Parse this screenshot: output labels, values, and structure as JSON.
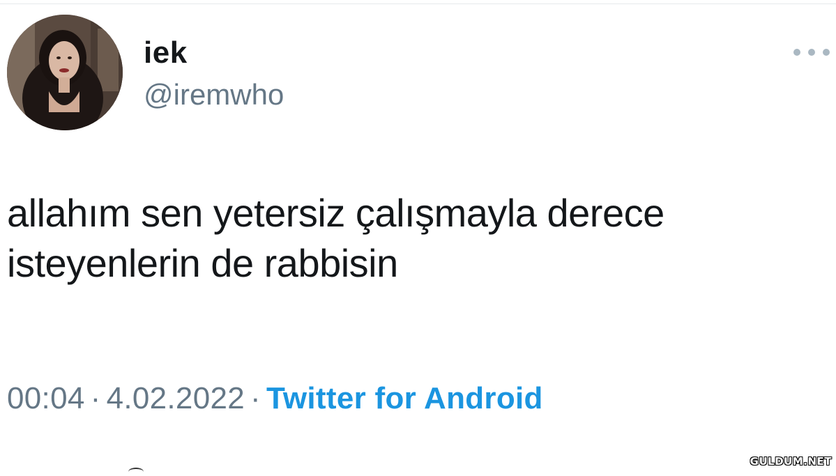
{
  "user": {
    "display_name": "iek",
    "handle": "@iremwho"
  },
  "tweet": {
    "line1": "allahım sen yetersiz çalışmayla derece",
    "line2": "isteyenlerin de rabbisin"
  },
  "meta": {
    "time": "00:04",
    "separator": "·",
    "date": "4.02.2022",
    "source": "Twitter for Android"
  },
  "watermark": "GULDUM.NET",
  "colors": {
    "text": "#14171a",
    "secondary": "#657786",
    "link": "#1b95e0",
    "more_dots": "#aab8c2"
  },
  "icons": {
    "more": "ellipsis-icon"
  }
}
